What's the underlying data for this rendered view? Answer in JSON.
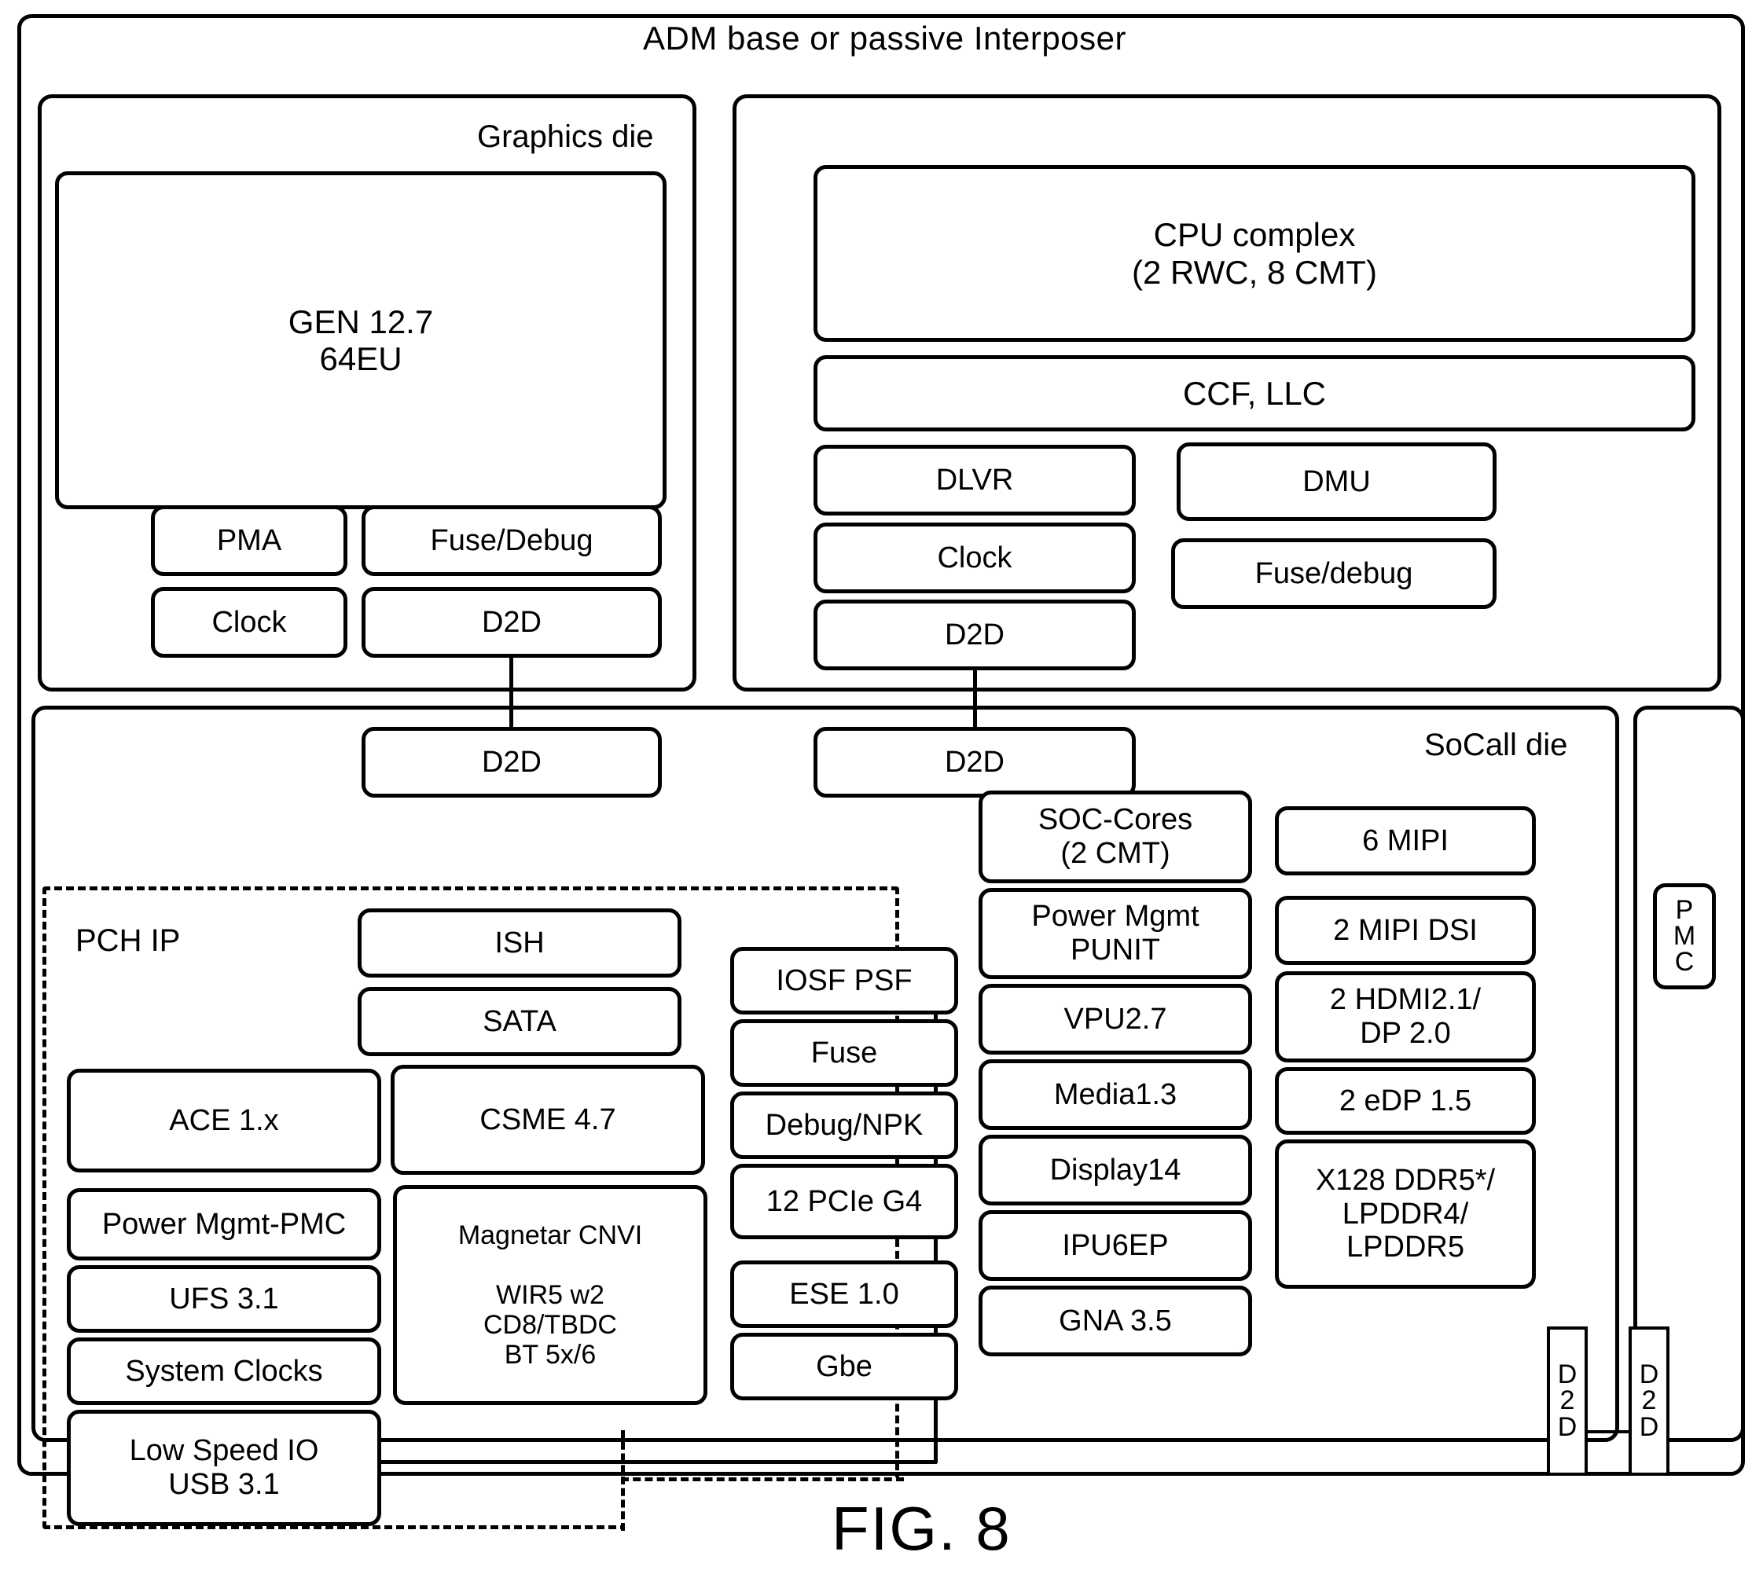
{
  "figure": {
    "caption": "FIG. 8",
    "package_label": "ADM base or passive Interposer"
  },
  "graphics_die": {
    "label": "Graphics die",
    "main_block": "GEN 12.7\n64EU",
    "blocks": [
      {
        "label": "PMA"
      },
      {
        "label": "Fuse/Debug"
      },
      {
        "label": "Clock"
      },
      {
        "label": "D2D"
      }
    ]
  },
  "cpu_die": {
    "label": "",
    "main_block": "CPU complex\n(2 RWC, 8 CMT)",
    "cache_block": "CCF, LLC",
    "left_blocks": [
      {
        "label": "DLVR"
      },
      {
        "label": "Clock"
      },
      {
        "label": "D2D"
      }
    ],
    "right_blocks": [
      {
        "label": "DMU"
      },
      {
        "label": "Fuse/debug"
      }
    ]
  },
  "soc_die": {
    "label": "SoCall die",
    "d2d_links": [
      {
        "label": "D2D"
      },
      {
        "label": "D2D"
      }
    ],
    "pch_ip": {
      "label": "PCH IP",
      "top_blocks": [
        {
          "label": "ISH"
        },
        {
          "label": "SATA"
        }
      ],
      "left_column": [
        {
          "label": "ACE 1.x"
        },
        {
          "label": "Power Mgmt-PMC"
        },
        {
          "label": "UFS 3.1"
        },
        {
          "label": "System Clocks"
        },
        {
          "label": "Low Speed IO\nUSB 3.1"
        }
      ],
      "right_column": [
        {
          "label": "CSME 4.7"
        },
        {
          "label": "Magnetar CNVI\n\nWIR5 w2\nCD8/TBDC\nBT 5x/6"
        }
      ]
    },
    "fabric_column": [
      {
        "label": "IOSF PSF"
      },
      {
        "label": "Fuse"
      },
      {
        "label": "Debug/NPK"
      },
      {
        "label": "12 PCIe G4"
      },
      {
        "label": "ESE 1.0"
      },
      {
        "label": "Gbe"
      }
    ],
    "core_column": [
      {
        "label": "SOC-Cores\n(2 CMT)"
      },
      {
        "label": "Power Mgmt\nPUNIT"
      },
      {
        "label": "VPU2.7"
      },
      {
        "label": "Media1.3"
      },
      {
        "label": "Display14"
      },
      {
        "label": "IPU6EP"
      },
      {
        "label": "GNA 3.5"
      }
    ],
    "io_column": [
      {
        "label": "6 MIPI"
      },
      {
        "label": "2 MIPI DSI"
      },
      {
        "label": "2 HDMI2.1/\nDP 2.0"
      },
      {
        "label": "2 eDP 1.5"
      },
      {
        "label": "X128 DDR5*/\nLPDDR4/\nLPDDR5"
      }
    ],
    "right_strip": {
      "pmc": "P\nM\nC",
      "d2d_left": "D\n2\nD",
      "d2d_right": "D\n2\nD"
    }
  },
  "colors": {
    "line": "#000000",
    "background": "#ffffff"
  }
}
